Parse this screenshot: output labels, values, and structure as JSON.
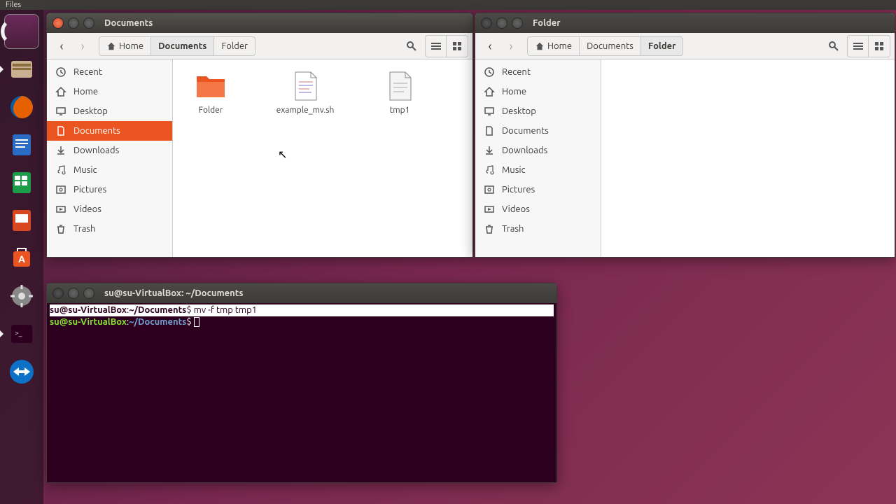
{
  "menubar": {
    "app": "Files"
  },
  "window1": {
    "title": "Documents",
    "breadcrumb": [
      "Home",
      "Documents",
      "Folder"
    ],
    "breadcrumb_active": 1,
    "sidebar": {
      "items": [
        {
          "label": "Recent"
        },
        {
          "label": "Home"
        },
        {
          "label": "Desktop"
        },
        {
          "label": "Documents"
        },
        {
          "label": "Downloads"
        },
        {
          "label": "Music"
        },
        {
          "label": "Pictures"
        },
        {
          "label": "Videos"
        },
        {
          "label": "Trash"
        }
      ],
      "active": 3
    },
    "files": [
      {
        "name": "Folder",
        "type": "folder"
      },
      {
        "name": "example_mv.sh",
        "type": "script"
      },
      {
        "name": "tmp1",
        "type": "text"
      }
    ]
  },
  "window2": {
    "title": "Folder",
    "breadcrumb": [
      "Home",
      "Documents",
      "Folder"
    ],
    "breadcrumb_active": 2,
    "sidebar": {
      "items": [
        {
          "label": "Recent"
        },
        {
          "label": "Home"
        },
        {
          "label": "Desktop"
        },
        {
          "label": "Documents"
        },
        {
          "label": "Downloads"
        },
        {
          "label": "Music"
        },
        {
          "label": "Pictures"
        },
        {
          "label": "Videos"
        },
        {
          "label": "Trash"
        }
      ],
      "active": -1
    },
    "files": []
  },
  "terminal": {
    "title": "su@su-VirtualBox: ~/Documents",
    "prompt_user": "su@su-VirtualBox",
    "prompt_path": "~/Documents",
    "lines": [
      {
        "cmd": "mv -f tmp tmp1",
        "selected": true
      },
      {
        "cmd": "",
        "selected": false,
        "cursor": true
      }
    ]
  }
}
